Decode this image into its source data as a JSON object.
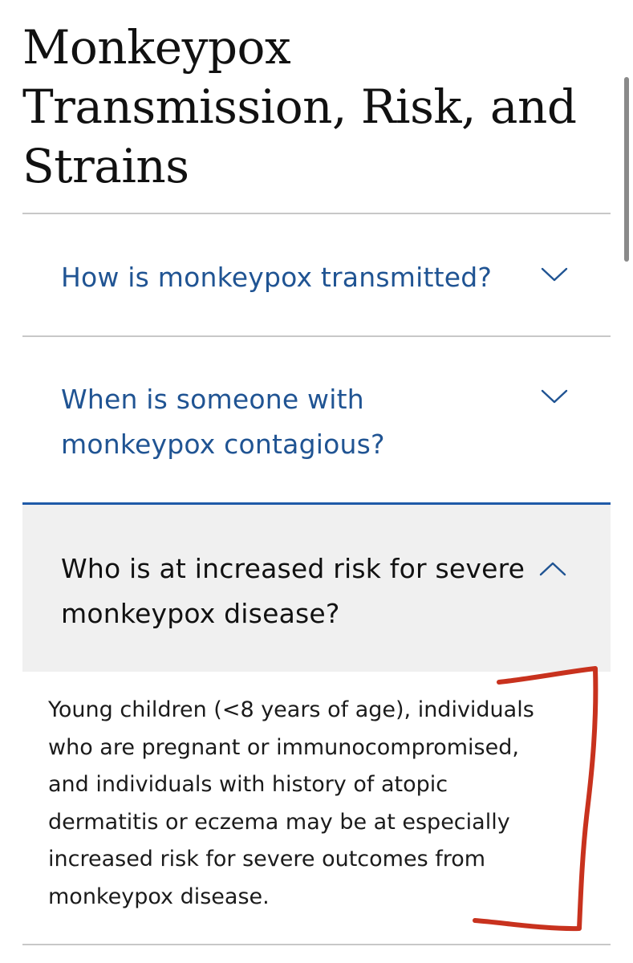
{
  "page": {
    "title_lines": [
      "Monkeypox",
      "Transmission, Risk, and",
      "Strains"
    ]
  },
  "accordion": {
    "items": [
      {
        "question_lines": [
          "How is monkeypox transmitted?"
        ],
        "expanded": false
      },
      {
        "question_lines": [
          "When is someone with",
          "monkeypox contagious?"
        ],
        "expanded": false
      },
      {
        "question_lines": [
          "Who is at increased risk for severe",
          "monkeypox disease?"
        ],
        "expanded": true,
        "answer_lines": [
          "Young children (<8 years of age), individuals",
          "who are pregnant or immunocompromised,",
          "and individuals with history of atopic",
          "dermatitis or eczema may be at especially",
          "increased risk for severe outcomes from",
          "monkeypox disease."
        ]
      }
    ]
  },
  "colors": {
    "link_blue": "#205493",
    "active_border": "#1f5aa8",
    "expanded_bg": "#f0f0f0",
    "divider": "#c8c8c8",
    "annotation_red": "#c8321e"
  },
  "icons": {
    "collapsed": "chevron-down-icon",
    "expanded": "chevron-up-icon"
  }
}
